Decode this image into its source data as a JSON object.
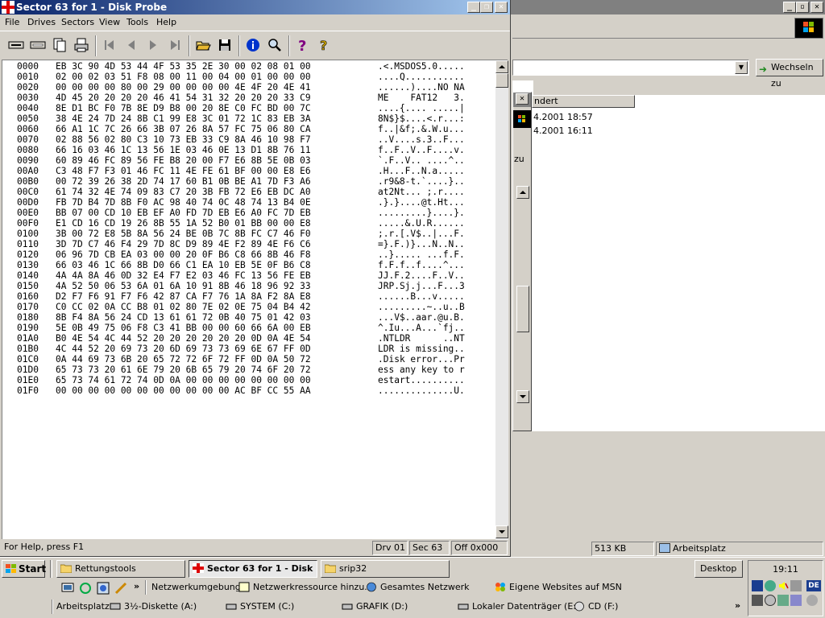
{
  "main_window": {
    "title": "Sector 63 for 1 - Disk Probe",
    "menu": [
      "File",
      "Drives",
      "Sectors",
      "View",
      "Tools",
      "Help"
    ],
    "toolbar_icons": [
      "read-sector-icon",
      "write-sector-icon",
      "copy-icon",
      "print-icon",
      "first-sector-icon",
      "previous-sector-icon",
      "next-sector-icon",
      "last-sector-icon",
      "open-file-icon",
      "save-icon",
      "info-icon",
      "search-icon",
      "help-icon",
      "context-help-icon"
    ],
    "hex_rows": [
      {
        "off": "0000",
        "hex": "EB 3C 90 4D 53 44 4F 53 35 2E 30 00 02 08 01 00",
        "ascii": ".<.MSDOS5.0....."
      },
      {
        "off": "0010",
        "hex": "02 00 02 03 51 F8 08 00 11 00 04 00 01 00 00 00",
        "ascii": "....Q..........."
      },
      {
        "off": "0020",
        "hex": "00 00 00 00 80 00 29 00 00 00 00 4E 4F 20 4E 41",
        "ascii": "......)....NO NA"
      },
      {
        "off": "0030",
        "hex": "4D 45 20 20 20 20 46 41 54 31 32 20 20 20 33 C9",
        "ascii": "ME    FAT12   3."
      },
      {
        "off": "0040",
        "hex": "8E D1 BC F0 7B 8E D9 B8 00 20 8E C0 FC BD 00 7C",
        "ascii": "....{.... .....|"
      },
      {
        "off": "0050",
        "hex": "38 4E 24 7D 24 8B C1 99 E8 3C 01 72 1C 83 EB 3A",
        "ascii": "8N$}$....<.r...:"
      },
      {
        "off": "0060",
        "hex": "66 A1 1C 7C 26 66 3B 07 26 8A 57 FC 75 06 80 CA",
        "ascii": "f..|&f;.&.W.u..."
      },
      {
        "off": "0070",
        "hex": "02 88 56 02 80 C3 10 73 EB 33 C9 8A 46 10 98 F7",
        "ascii": "..V....s.3..F..."
      },
      {
        "off": "0080",
        "hex": "66 16 03 46 1C 13 56 1E 03 46 0E 13 D1 8B 76 11",
        "ascii": "f..F..V..F....v."
      },
      {
        "off": "0090",
        "hex": "60 89 46 FC 89 56 FE B8 20 00 F7 E6 8B 5E 0B 03",
        "ascii": "`.F..V.. ....^.."
      },
      {
        "off": "00A0",
        "hex": "C3 48 F7 F3 01 46 FC 11 4E FE 61 BF 00 00 E8 E6",
        "ascii": ".H...F..N.a....."
      },
      {
        "off": "00B0",
        "hex": "00 72 39 26 38 2D 74 17 60 B1 0B BE A1 7D F3 A6",
        "ascii": ".r9&8-t.`....}.."
      },
      {
        "off": "00C0",
        "hex": "61 74 32 4E 74 09 83 C7 20 3B FB 72 E6 EB DC A0",
        "ascii": "at2Nt... ;.r...."
      },
      {
        "off": "00D0",
        "hex": "FB 7D B4 7D 8B F0 AC 98 40 74 0C 48 74 13 B4 0E",
        "ascii": ".}.}....@t.Ht..."
      },
      {
        "off": "00E0",
        "hex": "BB 07 00 CD 10 EB EF A0 FD 7D EB E6 A0 FC 7D EB",
        "ascii": ".........}....}."
      },
      {
        "off": "00F0",
        "hex": "E1 CD 16 CD 19 26 8B 55 1A 52 B0 01 BB 00 00 E8",
        "ascii": ".....&.U.R......"
      },
      {
        "off": "0100",
        "hex": "3B 00 72 E8 5B 8A 56 24 BE 0B 7C 8B FC C7 46 F0",
        "ascii": ";.r.[.V$..|...F."
      },
      {
        "off": "0110",
        "hex": "3D 7D C7 46 F4 29 7D 8C D9 89 4E F2 89 4E F6 C6",
        "ascii": "=}.F.)}...N..N.."
      },
      {
        "off": "0120",
        "hex": "06 96 7D CB EA 03 00 00 20 0F B6 C8 66 8B 46 F8",
        "ascii": "..}..... ...f.F."
      },
      {
        "off": "0130",
        "hex": "66 03 46 1C 66 8B D0 66 C1 EA 10 EB 5E 0F B6 C8",
        "ascii": "f.F.f..f....^..."
      },
      {
        "off": "0140",
        "hex": "4A 4A 8A 46 0D 32 E4 F7 E2 03 46 FC 13 56 FE EB",
        "ascii": "JJ.F.2....F..V.."
      },
      {
        "off": "0150",
        "hex": "4A 52 50 06 53 6A 01 6A 10 91 8B 46 18 96 92 33",
        "ascii": "JRP.Sj.j...F...3"
      },
      {
        "off": "0160",
        "hex": "D2 F7 F6 91 F7 F6 42 87 CA F7 76 1A 8A F2 8A E8",
        "ascii": "......B...v....."
      },
      {
        "off": "0170",
        "hex": "C0 CC 02 0A CC B8 01 02 80 7E 02 0E 75 04 B4 42",
        "ascii": ".........~..u..B"
      },
      {
        "off": "0180",
        "hex": "8B F4 8A 56 24 CD 13 61 61 72 0B 40 75 01 42 03",
        "ascii": "...V$..aar.@u.B."
      },
      {
        "off": "0190",
        "hex": "5E 0B 49 75 06 F8 C3 41 BB 00 00 60 66 6A 00 EB",
        "ascii": "^.Iu...A...`fj.."
      },
      {
        "off": "01A0",
        "hex": "B0 4E 54 4C 44 52 20 20 20 20 20 20 0D 0A 4E 54",
        "ascii": ".NTLDR      ..NT"
      },
      {
        "off": "01B0",
        "hex": "4C 44 52 20 69 73 20 6D 69 73 73 69 6E 67 FF 0D",
        "ascii": "LDR is missing.."
      },
      {
        "off": "01C0",
        "hex": "0A 44 69 73 6B 20 65 72 72 6F 72 FF 0D 0A 50 72",
        "ascii": ".Disk error...Pr"
      },
      {
        "off": "01D0",
        "hex": "65 73 73 20 61 6E 79 20 6B 65 79 20 74 6F 20 72",
        "ascii": "ess any key to r"
      },
      {
        "off": "01E0",
        "hex": "65 73 74 61 72 74 0D 0A 00 00 00 00 00 00 00 00",
        "ascii": "estart.........."
      },
      {
        "off": "01F0",
        "hex": "00 00 00 00 00 00 00 00 00 00 00 AC BF CC 55 AA",
        "ascii": "..............U."
      }
    ],
    "status": {
      "help": "For Help, press F1",
      "drive": "Drv  01",
      "sector": "Sec 63",
      "offset": "Off 0x000"
    }
  },
  "background_window": {
    "go_button": "Wechseln zu",
    "column_header": "ndert",
    "rows": [
      "4.2001 18:57",
      "4.2001 16:11"
    ],
    "dialog_label": "zu",
    "status_size": "513 KB",
    "status_location": "Arbeitsplatz"
  },
  "taskbar": {
    "start": "Start",
    "tasks": [
      "Rettungstools",
      "Sector 63 for 1 - Disk ...",
      "srip32"
    ],
    "desktop": "Desktop",
    "clock": "19:11",
    "quicklaunch_chevron": "»",
    "links_row": [
      "Netzwerkumgebung",
      "Netzwerkressource hinzu...",
      "Gesamtes Netzwerk",
      "Eigene Websites auf MSN"
    ],
    "drives_row": [
      "Arbeitsplatz",
      "3½-Diskette (A:)",
      "SYSTEM (C:)",
      "GRAFIK (D:)",
      "Lokaler Datenträger (E:)",
      "CD (F:)"
    ],
    "tray_lang": "DE"
  },
  "colors": {
    "title_active_start": "#0a246a",
    "title_active_end": "#a6caf0",
    "face": "#d4d0c8",
    "desktop": "#3a6ea5"
  }
}
